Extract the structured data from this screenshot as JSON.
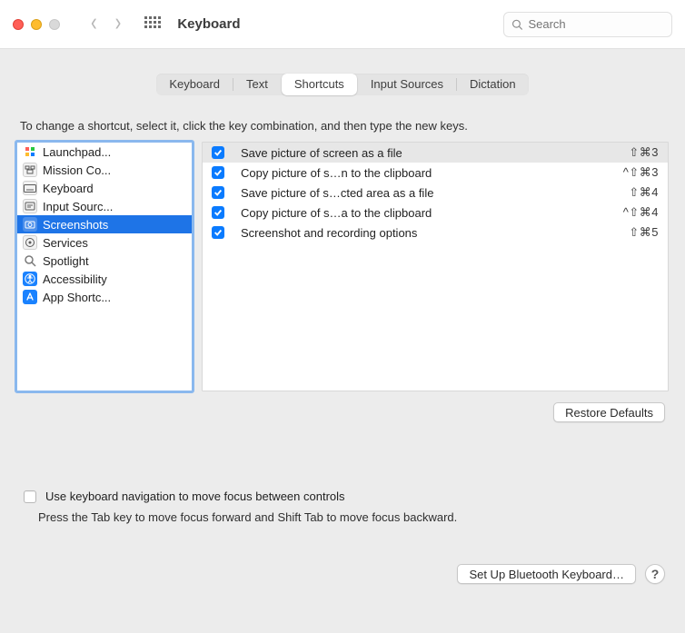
{
  "window": {
    "title": "Keyboard"
  },
  "search": {
    "placeholder": "Search"
  },
  "tabs": [
    "Keyboard",
    "Text",
    "Shortcuts",
    "Input Sources",
    "Dictation"
  ],
  "active_tab": 2,
  "hint": "To change a shortcut, select it, click the key combination, and then type the new keys.",
  "categories": [
    {
      "icon": "launchpad",
      "label": "Launchpad..."
    },
    {
      "icon": "mission",
      "label": "Mission Co..."
    },
    {
      "icon": "keyboard",
      "label": "Keyboard"
    },
    {
      "icon": "input",
      "label": "Input Sourc..."
    },
    {
      "icon": "screenshots",
      "label": "Screenshots",
      "selected": true
    },
    {
      "icon": "services",
      "label": "Services"
    },
    {
      "icon": "spotlight",
      "label": "Spotlight"
    },
    {
      "icon": "accessibility",
      "label": "Accessibility"
    },
    {
      "icon": "appstore",
      "label": "App Shortc..."
    }
  ],
  "shortcuts": [
    {
      "checked": true,
      "label": "Save picture of screen as a file",
      "keys": "⇧⌘3",
      "selected": true
    },
    {
      "checked": true,
      "label": "Copy picture of s…n to the clipboard",
      "keys": "^⇧⌘3"
    },
    {
      "checked": true,
      "label": "Save picture of s…cted area as a file",
      "keys": "⇧⌘4"
    },
    {
      "checked": true,
      "label": "Copy picture of s…a to the clipboard",
      "keys": "^⇧⌘4"
    },
    {
      "checked": true,
      "label": "Screenshot and recording options",
      "keys": "⇧⌘5"
    }
  ],
  "restore_label": "Restore Defaults",
  "kb_nav": {
    "checked": false,
    "label": "Use keyboard navigation to move focus between controls",
    "sub": "Press the Tab key to move focus forward and Shift Tab to move focus backward."
  },
  "footer": {
    "bluetooth": "Set Up Bluetooth Keyboard…",
    "help": "?"
  }
}
